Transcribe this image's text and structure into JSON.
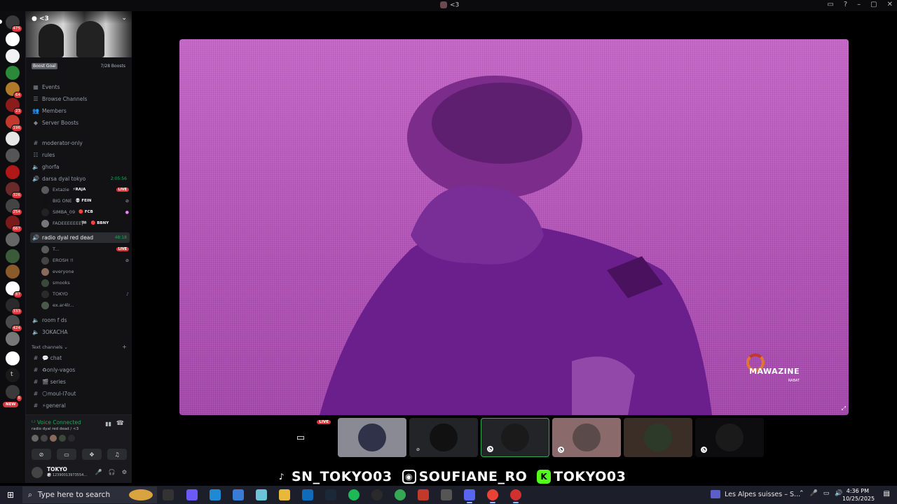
{
  "window": {
    "title": "<3"
  },
  "rail": {
    "servers": [
      {
        "badge": "475",
        "color": "#3a3a3a"
      },
      {
        "badge": "",
        "color": "#ffffff"
      },
      {
        "badge": "",
        "color": "#f2f2f2"
      },
      {
        "badge": "",
        "color": "#2a8a3a"
      },
      {
        "badge": "64",
        "color": "#b07a2a"
      },
      {
        "badge": "23",
        "color": "#8a1c1c"
      },
      {
        "badge": "196",
        "color": "#c0392b"
      },
      {
        "badge": "",
        "color": "#e6e6e6"
      },
      {
        "badge": "",
        "color": "#555555"
      },
      {
        "badge": "",
        "color": "#b01818"
      },
      {
        "badge": "326",
        "color": "#6a2a2a"
      },
      {
        "badge": "254",
        "color": "#444444"
      },
      {
        "badge": "667",
        "color": "#7a1a1a"
      },
      {
        "badge": "",
        "color": "#666666"
      },
      {
        "badge": "",
        "color": "#3a5a3a"
      },
      {
        "badge": "",
        "color": "#8a5a2a"
      },
      {
        "badge": "87",
        "color": "#ffffff"
      },
      {
        "badge": "333",
        "color": "#2a2a2a"
      },
      {
        "badge": "424",
        "color": "#4a4a4a"
      },
      {
        "badge": "",
        "color": "#777777"
      },
      {
        "badge": "",
        "color": "#ffffff"
      },
      {
        "badge": "",
        "color": "#1a1a1a"
      },
      {
        "badge": "8",
        "color": "#3a3a3a"
      }
    ],
    "new_label": "NEW",
    "t_label": "t"
  },
  "sidebar": {
    "server_name": "<3",
    "boost_goal": "Boost Goal",
    "boost_count": "7/28 Boosts",
    "nav": [
      "Events",
      "Browse Channels",
      "Members",
      "Server Boosts"
    ],
    "channels": [
      "moderator-only",
      "rules",
      "ghorfa"
    ],
    "voice1": {
      "name": "darsa dyal tokyo",
      "time": "2:05:56"
    },
    "voice1_users": [
      {
        "name": "Extazie",
        "tag": "⚡RAJA",
        "live": "LIVE"
      },
      {
        "name": "BIG ONE",
        "tag": "💀 FEIN"
      },
      {
        "name": "SIMBA_09",
        "tag": "🔴 FCB"
      },
      {
        "name": "FADEEEEEEE🏁",
        "tag": "🔴 BBNY"
      }
    ],
    "voice2": {
      "name": "radio dyal red dead",
      "time": "48:18"
    },
    "voice2_users": [
      {
        "name": "T...",
        "live": "LIVE"
      },
      {
        "name": "EROSH !!"
      },
      {
        "name": "everyone"
      },
      {
        "name": "smooks"
      },
      {
        "name": "TOKYO"
      },
      {
        "name": "ex.ar4lr..."
      }
    ],
    "voice3": [
      "room f ds",
      "3OKACHA"
    ],
    "text_category": "Text channels",
    "text_channels": [
      "💬 chat",
      "♻only-vagos",
      "🎬 series",
      "🌕moul-l7out",
      "⚡general"
    ]
  },
  "voice_panel": {
    "status": "Voice Connected",
    "sub": "radio dyal red dead / <3"
  },
  "user_panel": {
    "name": "TOKYO",
    "status": "🎲 12390013973554..."
  },
  "stage": {
    "video_logo": "MAWAZINE",
    "video_logo_sub": "RABAT",
    "tiles_live": "LIVE"
  },
  "socials": {
    "tiktok": "SN_TOKYO03",
    "instagram": "SOUFIANE_RO",
    "kick": "TOKYO03"
  },
  "taskbar": {
    "search_placeholder": "Type here to search",
    "media_title": "Les Alpes suisses – S...",
    "time": "4:36 PM",
    "date": "10/25/2025"
  }
}
